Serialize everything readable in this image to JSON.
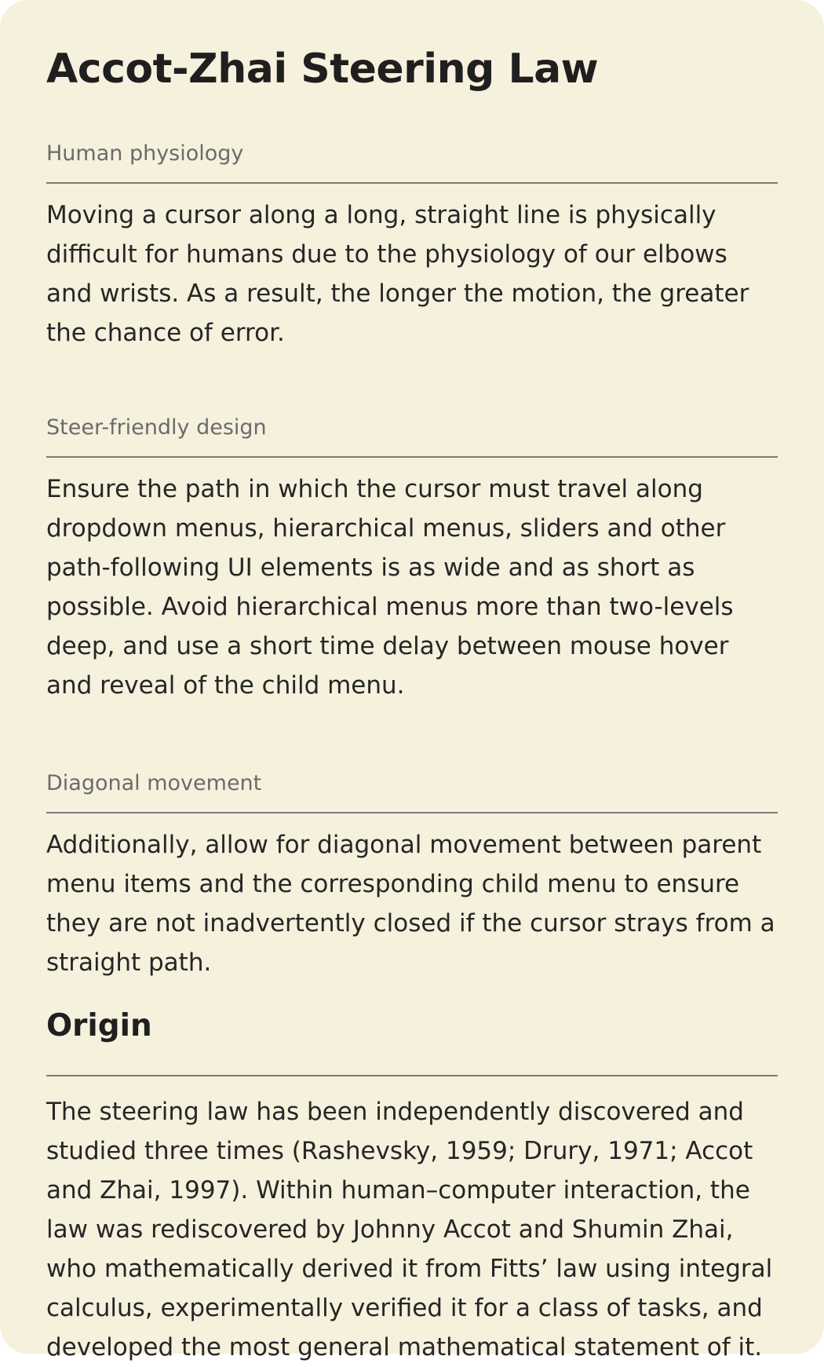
{
  "title": "Accot-Zhai Steering Law",
  "sections": [
    {
      "label": "Human physiology",
      "body": "Moving a cursor along a long, straight line is physically difficult for humans due to the physiology of our elbows and wrists. As a result, the longer the motion, the greater the chance of error."
    },
    {
      "label": "Steer-friendly design",
      "body": "Ensure the path in which the cursor must travel along dropdown menus, hierarchical menus, sliders and other path-following UI elements is as wide and as short as possible. Avoid hierarchical menus more than two-levels deep, and use a short time delay between mouse hover and reveal of the child menu."
    },
    {
      "label": "Diagonal movement",
      "body": "Additionally, allow for diagonal movement between parent menu items and the corresponding child menu to ensure they are not inadvertently closed if the cursor strays from a straight path."
    }
  ],
  "origin": {
    "heading": "Origin",
    "body": "The steering law has been independently discovered and studied three times (Rashevsky, 1959; Drury, 1971; Accot and Zhai, 1997). Within human–computer interaction, the law was rediscovered by Johnny Accot and Shumin Zhai, who mathematically derived it from Fitts’ law using integral calculus, experimentally verified it for a class of tasks, and developed the most general mathematical statement of it."
  }
}
